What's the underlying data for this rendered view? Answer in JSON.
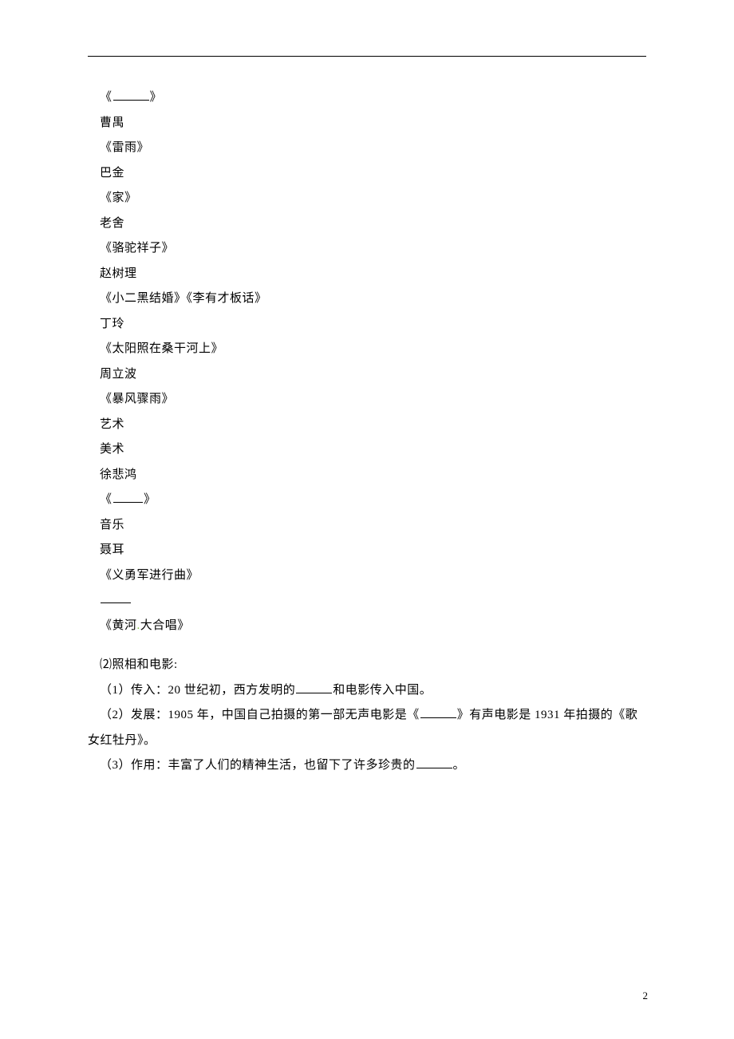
{
  "lines": {
    "l01a": "《",
    "l01b": "》",
    "l02": "曹禺",
    "l03": "《雷雨》",
    "l04": "巴金",
    "l05": "《家》",
    "l06": "老舍",
    "l07": "《骆驼祥子》",
    "l08": "赵树理",
    "l09": "《小二黑结婚》《李有才板话》",
    "l10": "丁玲",
    "l11": "《太阳照在桑干河上》",
    "l12": "周立波",
    "l13": "《暴风骤雨》",
    "l14": "艺术",
    "l15": "美术",
    "l16": "徐悲鸿",
    "l17a": "《",
    "l17b": "》",
    "l18": "音乐",
    "l19": "聂耳",
    "l20": "《义勇军进行曲》",
    "l21": "",
    "l22a": "《黄河",
    "l22b": "大合唱》",
    "l23": "⑵照相和电影:",
    "l24a": "（1）传入：20 世纪初，西方发明的",
    "l24b": "和电影传入中国。",
    "l25a": "（2）发展：1905 年，中国自己拍摄的第一部无声电影是《",
    "l25b": "》有声电影是 1931 年拍摄的《歌",
    "l26": "女红牡丹》。",
    "l27a": "（3）作用：丰富了人们的精神生活，也留下了许多珍贵的",
    "l27b": "。"
  },
  "page_number": "2"
}
